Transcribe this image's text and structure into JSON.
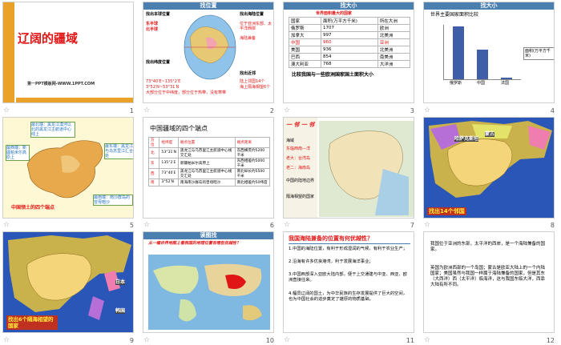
{
  "slides": [
    {
      "n": "1",
      "title": "辽阔的疆域",
      "sub": "第一PPT模板网-WWW.1PPT.COM"
    },
    {
      "n": "2",
      "hdr": "找位置",
      "l1": "找出本球位置",
      "l2": "东半球",
      "l3": "北半球",
      "l4": "找出纬度位置",
      "l5": "73°40′E~135°2′E",
      "l6": "3°52′N~53°31′N",
      "l7": "大部分位于中纬度，部分位于热带，没有寒带",
      "r1": "找出海陆位置",
      "r2": "位于亚洲东部、太平洋西岸",
      "r3": "海陆兼备",
      "r4": "找出近邻",
      "r5": "陆上邻国14个",
      "r6": "海上隔海相望6个"
    },
    {
      "n": "3",
      "hdr": "找大小",
      "title": "世界面积最大的国家",
      "cols": [
        "国家",
        "面积(万平方千米)",
        "所在大洲"
      ],
      "rows": [
        [
          "俄罗斯",
          "1707",
          "欧洲"
        ],
        [
          "加拿大",
          "997",
          "北美洲"
        ],
        [
          "中国",
          "960",
          "亚洲"
        ],
        [
          "美国",
          "936",
          "北美洲"
        ],
        [
          "巴西",
          "854",
          "南美洲"
        ],
        [
          "澳大利亚",
          "768",
          "大洋洲"
        ]
      ],
      "foot": "比较我国与一些欧洲国家国土面积大小"
    },
    {
      "n": "4",
      "hdr": "找大小",
      "title": "世界主要国家面积比较",
      "labels": [
        "俄罗斯",
        "中国",
        "法国"
      ],
      "legend": "面积(万平方千米)"
    },
    {
      "n": "5",
      "t1": "最北端：黑龙江漠河以北的黑龙江主航道中心线上",
      "t2": "最东端：黑龙江与乌苏里江汇合处",
      "t3": "最西端：新疆帕米尔高原上",
      "t4": "最南端：南沙群岛的曾母暗沙",
      "foot": "中国领土的四个端点"
    },
    {
      "n": "6",
      "title": "中国疆域的四个端点",
      "cols": [
        "方位",
        "经纬度",
        "端点位置",
        "端点距离"
      ],
      "rows": [
        [
          "北",
          "53°31′N",
          "黑龙江与乌苏里江主航道中心线交汇处",
          "东西横贯约5200千米"
        ],
        [
          "东",
          "135°2′E",
          "新疆帕米尔高原上",
          "东西相差约5000千米"
        ],
        [
          "西",
          "73°40′E",
          "黑龙江与乌苏里江主航道中心线交汇处",
          "南北纵长约5500千米"
        ],
        [
          "南",
          "3°52′N",
          "南海南沙群岛的曾母暗沙",
          "南北相差约50纬度"
        ]
      ]
    },
    {
      "n": "7",
      "tag": "一 邻  一 邻",
      "s1": "海域",
      "s2": "东临西南—洋",
      "s3": "老大：台湾岛",
      "s4": "老二：海南岛",
      "s5": "中国的陆地边界",
      "s6": "隔海相望的国家"
    },
    {
      "n": "8",
      "tag": "找出14个邻国",
      "l1": "哈萨克斯坦",
      "l2": "蒙古"
    },
    {
      "n": "9",
      "tag": "找出6个隔海相望的国家",
      "r1": "日本",
      "r2": "韩国"
    },
    {
      "n": "10",
      "hdr": "读图找",
      "q": "从一幅世界地图上看我国的地理位置有哪些优越性？"
    },
    {
      "n": "11",
      "q": "我国海陆兼备的位置有何优越性？",
      "p1": "1.中国的海陆位置，有利于形成湿润的气候，有利于农业生产；",
      "p2": "2.沿海有许多优良港湾，利于发展海洋事业；",
      "p3": "3.中国西部深入亚欧大陆内部，便于上交通建与中亚、西亚、欧洲直接往来。",
      "p4": "4.幅员辽阔的国土，为中华民族的生存发展提供了巨大的空间，也为中国社会的进步奠定了雄厚的物质基础。"
    },
    {
      "n": "12",
      "p1": "我国位于亚洲的东部，太平洋的西岸，是一个海陆兼备的国家。",
      "p2": "英国为欧洲西部的一个岛国；蒙古是欧亚大陆上的一个内陆国家；美国虽然与我国一样属于海陆兼备的国家，但是其东（大西洋）西（太平洋）临海洋，这与我国东临大洋，西靠大陆有所不同。"
    }
  ],
  "colors": {
    "orange": "#e28a10",
    "blue": "#4a7fb0",
    "red": "#e01515",
    "yellow": "#ffef3a"
  }
}
